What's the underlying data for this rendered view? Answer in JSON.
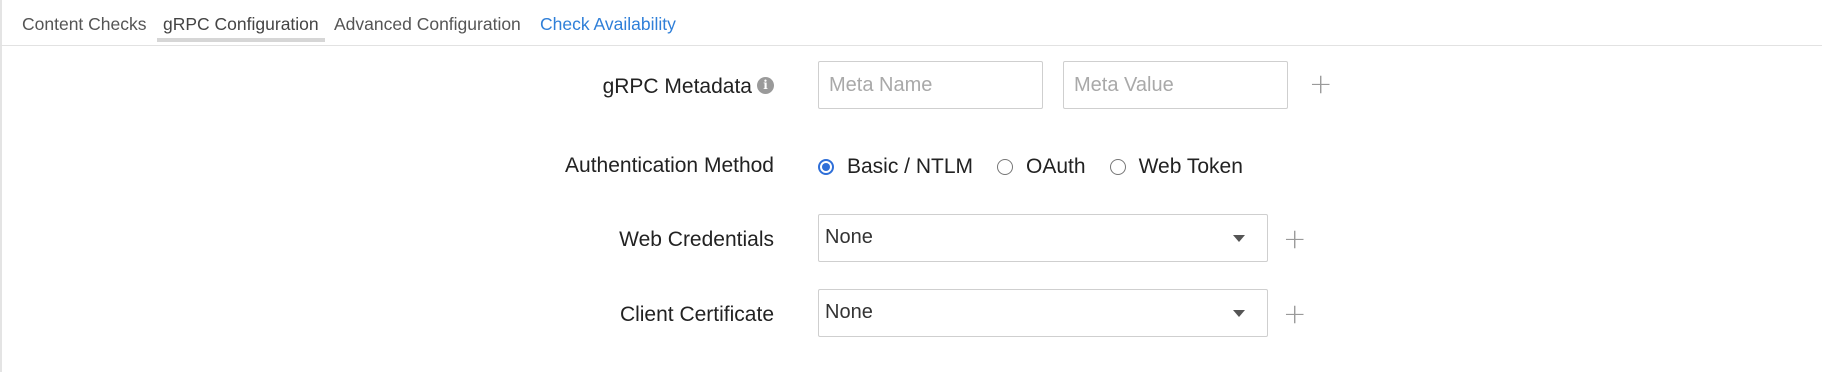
{
  "tabs": [
    {
      "label": "Content Checks",
      "state": "normal"
    },
    {
      "label": "gRPC Configuration",
      "state": "active"
    },
    {
      "label": "Advanced Configuration",
      "state": "normal"
    },
    {
      "label": "Check Availability",
      "state": "link"
    }
  ],
  "grpc_metadata": {
    "label": "gRPC Metadata",
    "info_icon": "info-icon",
    "name_placeholder": "Meta Name",
    "value_placeholder": "Meta Value",
    "add_icon": "plus-icon"
  },
  "authentication": {
    "label": "Authentication Method",
    "options": [
      {
        "label": "Basic / NTLM",
        "checked": true
      },
      {
        "label": "OAuth",
        "checked": false
      },
      {
        "label": "Web Token",
        "checked": false
      }
    ]
  },
  "web_credentials": {
    "label": "Web Credentials",
    "value": "None",
    "add_icon": "plus-icon"
  },
  "client_certificate": {
    "label": "Client Certificate",
    "value": "None",
    "add_icon": "plus-icon"
  },
  "colors": {
    "link": "#2f7fd8",
    "radio_checked": "#2f6fd8",
    "border": "#cfcfcf",
    "placeholder": "#a9a9a9"
  }
}
